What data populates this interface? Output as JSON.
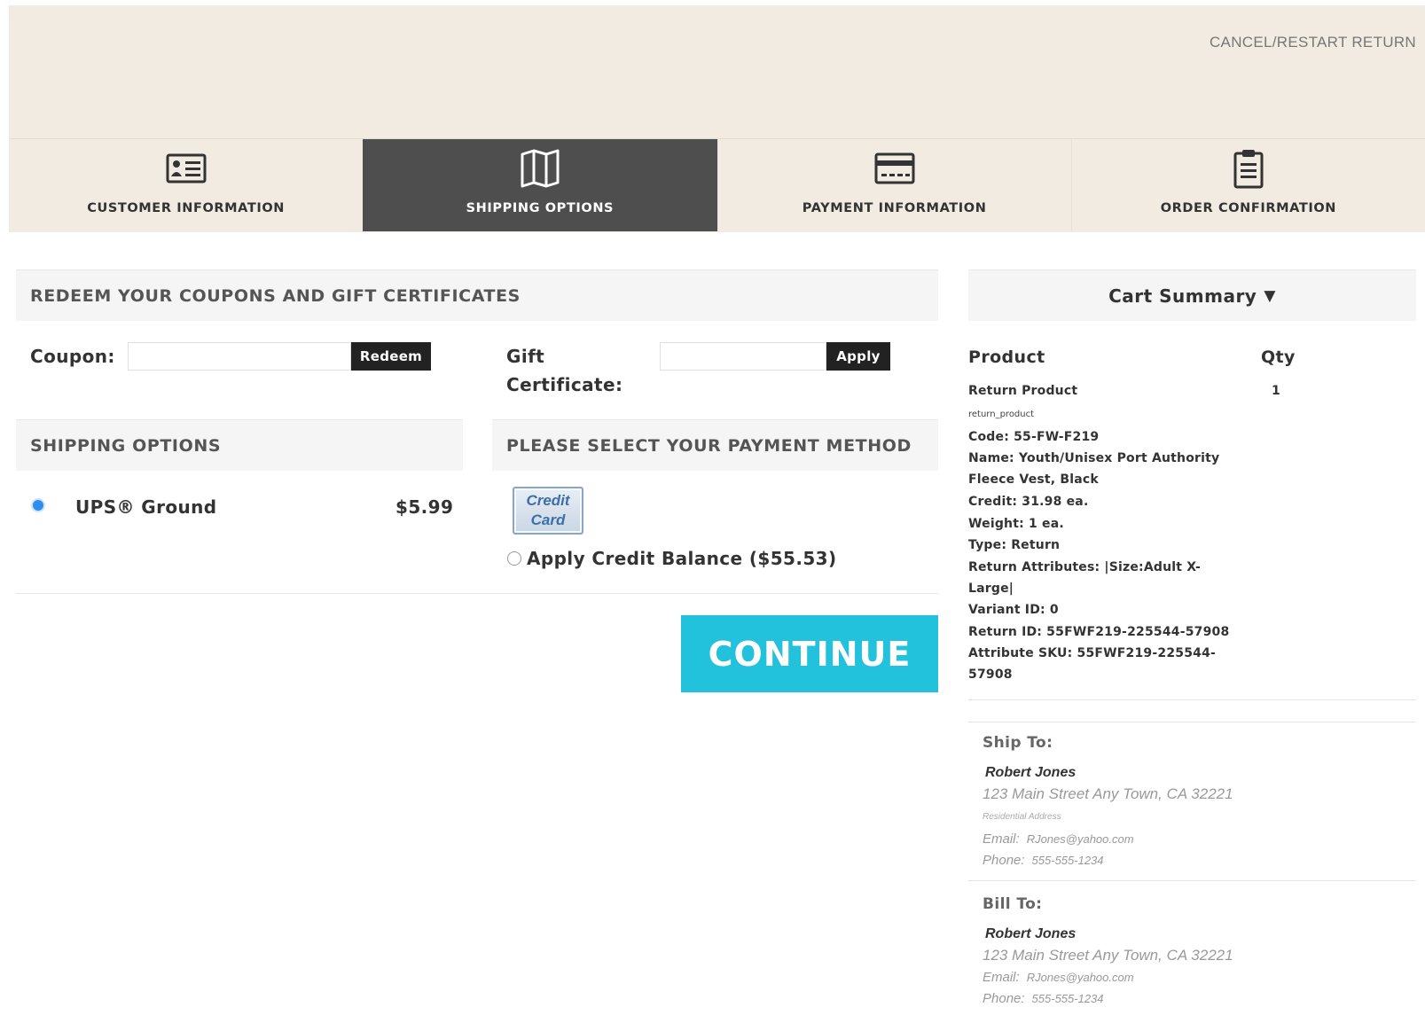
{
  "header": {
    "cancel_link": "CANCEL/RESTART RETURN"
  },
  "steps": [
    {
      "label": "CUSTOMER INFORMATION",
      "icon": "id-card-icon",
      "active": false
    },
    {
      "label": "SHIPPING OPTIONS",
      "icon": "map-icon",
      "active": true
    },
    {
      "label": "PAYMENT INFORMATION",
      "icon": "credit-card-icon",
      "active": false
    },
    {
      "label": "ORDER CONFIRMATION",
      "icon": "clipboard-icon",
      "active": false
    }
  ],
  "redeem": {
    "title": "REDEEM YOUR COUPONS AND GIFT CERTIFICATES",
    "coupon_label": "Coupon:",
    "coupon_value": "",
    "redeem_button": "Redeem",
    "gift_label_line1": "Gift",
    "gift_label_line2": "Certificate:",
    "gift_value": "",
    "apply_button": "Apply"
  },
  "shipping": {
    "title": "SHIPPING OPTIONS",
    "option_label": "UPS® Ground",
    "option_price": "$5.99",
    "selected": true
  },
  "payment": {
    "title": "PLEASE SELECT YOUR PAYMENT METHOD",
    "credit_card_line1": "Credit",
    "credit_card_line2": "Card",
    "credit_balance_label": "Apply Credit Balance ($55.53)"
  },
  "continue_button": "CONTINUE",
  "cart": {
    "title": "Cart Summary",
    "toggle_glyph": "▼",
    "col_product": "Product",
    "col_qty": "Qty",
    "product_name": "Return Product",
    "qty": "1",
    "product_slug": "return_product",
    "details": [
      "Code: 55-FW-F219",
      "Name: Youth/Unisex Port Authority",
      "Fleece Vest, Black",
      "Credit: 31.98 ea.",
      "Weight: 1 ea.",
      "Type: Return",
      "Return Attributes: |Size:Adult X-",
      "Large|",
      "Variant ID: 0",
      "Return ID: 55FWF219-225544-57908",
      "Attribute SKU: 55FWF219-225544-",
      "57908"
    ]
  },
  "ship_to": {
    "title": "Ship To:",
    "name": "Robert Jones",
    "address": "123 Main Street  Any Town, CA 32221",
    "address_type": "Residential Address",
    "email_label": "Email:",
    "email": "RJones@yahoo.com",
    "phone_label": "Phone:",
    "phone": "555-555-1234"
  },
  "bill_to": {
    "title": "Bill To:",
    "name": "Robert Jones",
    "address": "123 Main Street  Any Town, CA 32221",
    "email_label": "Email:",
    "email": "RJones@yahoo.com",
    "phone_label": "Phone:",
    "phone": "555-555-1234"
  }
}
